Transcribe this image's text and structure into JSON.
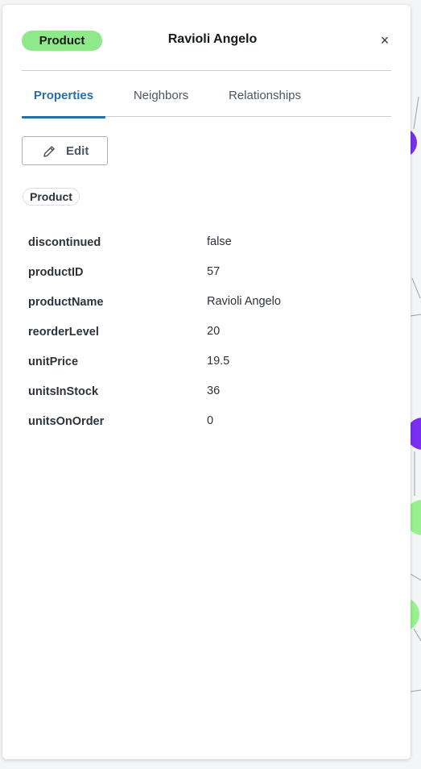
{
  "panel": {
    "label": "Product",
    "title": "Ravioli Angelo",
    "close_label": "×"
  },
  "tabs": [
    {
      "label": "Properties",
      "active": true
    },
    {
      "label": "Neighbors",
      "active": false
    },
    {
      "label": "Relationships",
      "active": false
    }
  ],
  "edit_label": "Edit",
  "chip_label": "Product",
  "properties": [
    {
      "key": "discontinued",
      "value": "false"
    },
    {
      "key": "productID",
      "value": "57"
    },
    {
      "key": "productName",
      "value": "Ravioli Angelo"
    },
    {
      "key": "reorderLevel",
      "value": "20"
    },
    {
      "key": "unitPrice",
      "value": "19.5"
    },
    {
      "key": "unitsInStock",
      "value": "36"
    },
    {
      "key": "unitsOnOrder",
      "value": "0"
    }
  ],
  "colors": {
    "label_pill": "#8fe889",
    "active_tab": "#2a6ea6",
    "graph_node_purple": "#7a2ff0",
    "graph_node_green": "#98f08f"
  }
}
